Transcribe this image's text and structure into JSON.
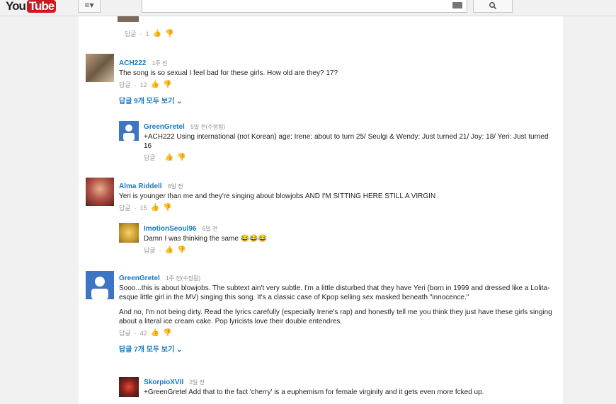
{
  "header": {
    "logo_you": "You",
    "logo_tube": "Tube",
    "guide_label": "≡▾",
    "search_icon": "magnifier-icon"
  },
  "top_fragment": {
    "reply": "답글",
    "dot": "·",
    "likes": "1"
  },
  "comments": [
    {
      "author": "ACH222",
      "time": "1주 전",
      "text": "The song is so sexual I feel bad for these girls. How old are they? 17?",
      "reply": "답글",
      "likes": "12",
      "view_replies": "답글 9개 모두 보기 ⌄",
      "replies": [
        {
          "author": "GreenGretel",
          "time": "5일 전(수정됨)",
          "text": "+ACH222 Using international (not Korean) age: Irene: about to turn 25/   Seulgi & Wendy: Just turned 21/  Joy: 18/    Yeri: Just turned 16",
          "reply": "답글"
        }
      ]
    },
    {
      "author": "Alma Riddell",
      "time": "6일 전",
      "text": "Yeri is younger than me and they're singing about blowjobs AND I'M SITTING HERE STILL A VIRGIN",
      "reply": "답글",
      "likes": "15",
      "replies": [
        {
          "author": "ImotionSeoul96",
          "time": "6일 전",
          "text": "Damn I was thinking the same 😂😂😂",
          "reply": "답글"
        }
      ]
    },
    {
      "author": "GreenGretel",
      "time": "1주 전(수정됨)",
      "text1": "Sooo...this is about blowjobs. The subtext ain't very subtle. I'm a little disturbed that they have Yeri (born in 1999 and dressed like a Lolita-esque little girl in the MV) singing this song.  It's a classic case of Kpop selling sex masked beneath \"innocence.\"",
      "text2": "And no, I'm not being dirty. Read the lyrics carefully (especially Irene's rap) and honestly tell me you think they just have these girls singing about a literal ice cream cake.  Pop lyricists love their double entendres.",
      "reply": "답글",
      "likes": "42",
      "view_replies": "답글 7개 모두 보기 ⌄",
      "replies": [
        {
          "author": "SkorpioXVII",
          "time": "2일 전",
          "text": "+GreenGretel Add that to the fact 'cherry' is a euphemism for female virginity and it gets even more fcked up."
        }
      ]
    }
  ],
  "icons": {
    "like": "thumbs-up-icon",
    "dislike": "thumbs-down-icon"
  },
  "colors": {
    "link": "#167ac6",
    "youtube_red": "#cc181e",
    "gutter": "#f1f1f1"
  }
}
